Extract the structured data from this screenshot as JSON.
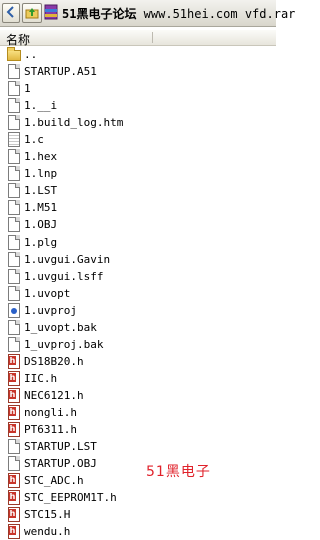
{
  "titlebar": {
    "title_prefix": "51黑电子论坛",
    "title_rest": " www.51hei.com vfd.rar"
  },
  "header": {
    "name_column": "名称"
  },
  "files": [
    {
      "name": "..",
      "type": "folder"
    },
    {
      "name": "STARTUP.A51",
      "type": "file"
    },
    {
      "name": "1",
      "type": "file"
    },
    {
      "name": "1.__i",
      "type": "file"
    },
    {
      "name": "1.build_log.htm",
      "type": "file"
    },
    {
      "name": "1.c",
      "type": "text-file"
    },
    {
      "name": "1.hex",
      "type": "file"
    },
    {
      "name": "1.lnp",
      "type": "file"
    },
    {
      "name": "1.LST",
      "type": "file"
    },
    {
      "name": "1.M51",
      "type": "file"
    },
    {
      "name": "1.OBJ",
      "type": "file"
    },
    {
      "name": "1.plg",
      "type": "file"
    },
    {
      "name": "1.uvgui.Gavin",
      "type": "file"
    },
    {
      "name": "1.uvgui.lsff",
      "type": "file"
    },
    {
      "name": "1.uvopt",
      "type": "file"
    },
    {
      "name": "1.uvproj",
      "type": "uvproj"
    },
    {
      "name": "1_uvopt.bak",
      "type": "file"
    },
    {
      "name": "1_uvproj.bak",
      "type": "file"
    },
    {
      "name": "DS18B20.h",
      "type": "header-file"
    },
    {
      "name": "IIC.h",
      "type": "header-file"
    },
    {
      "name": "NEC6121.h",
      "type": "header-file"
    },
    {
      "name": "nongli.h",
      "type": "header-file"
    },
    {
      "name": "PT6311.h",
      "type": "header-file"
    },
    {
      "name": "STARTUP.LST",
      "type": "file"
    },
    {
      "name": "STARTUP.OBJ",
      "type": "file"
    },
    {
      "name": "STC_ADC.h",
      "type": "header-file"
    },
    {
      "name": "STC_EEPROM1T.h",
      "type": "header-file"
    },
    {
      "name": "STC15.H",
      "type": "header-file"
    },
    {
      "name": "wendu.h",
      "type": "header-file"
    }
  ],
  "watermark": "51黑电子"
}
